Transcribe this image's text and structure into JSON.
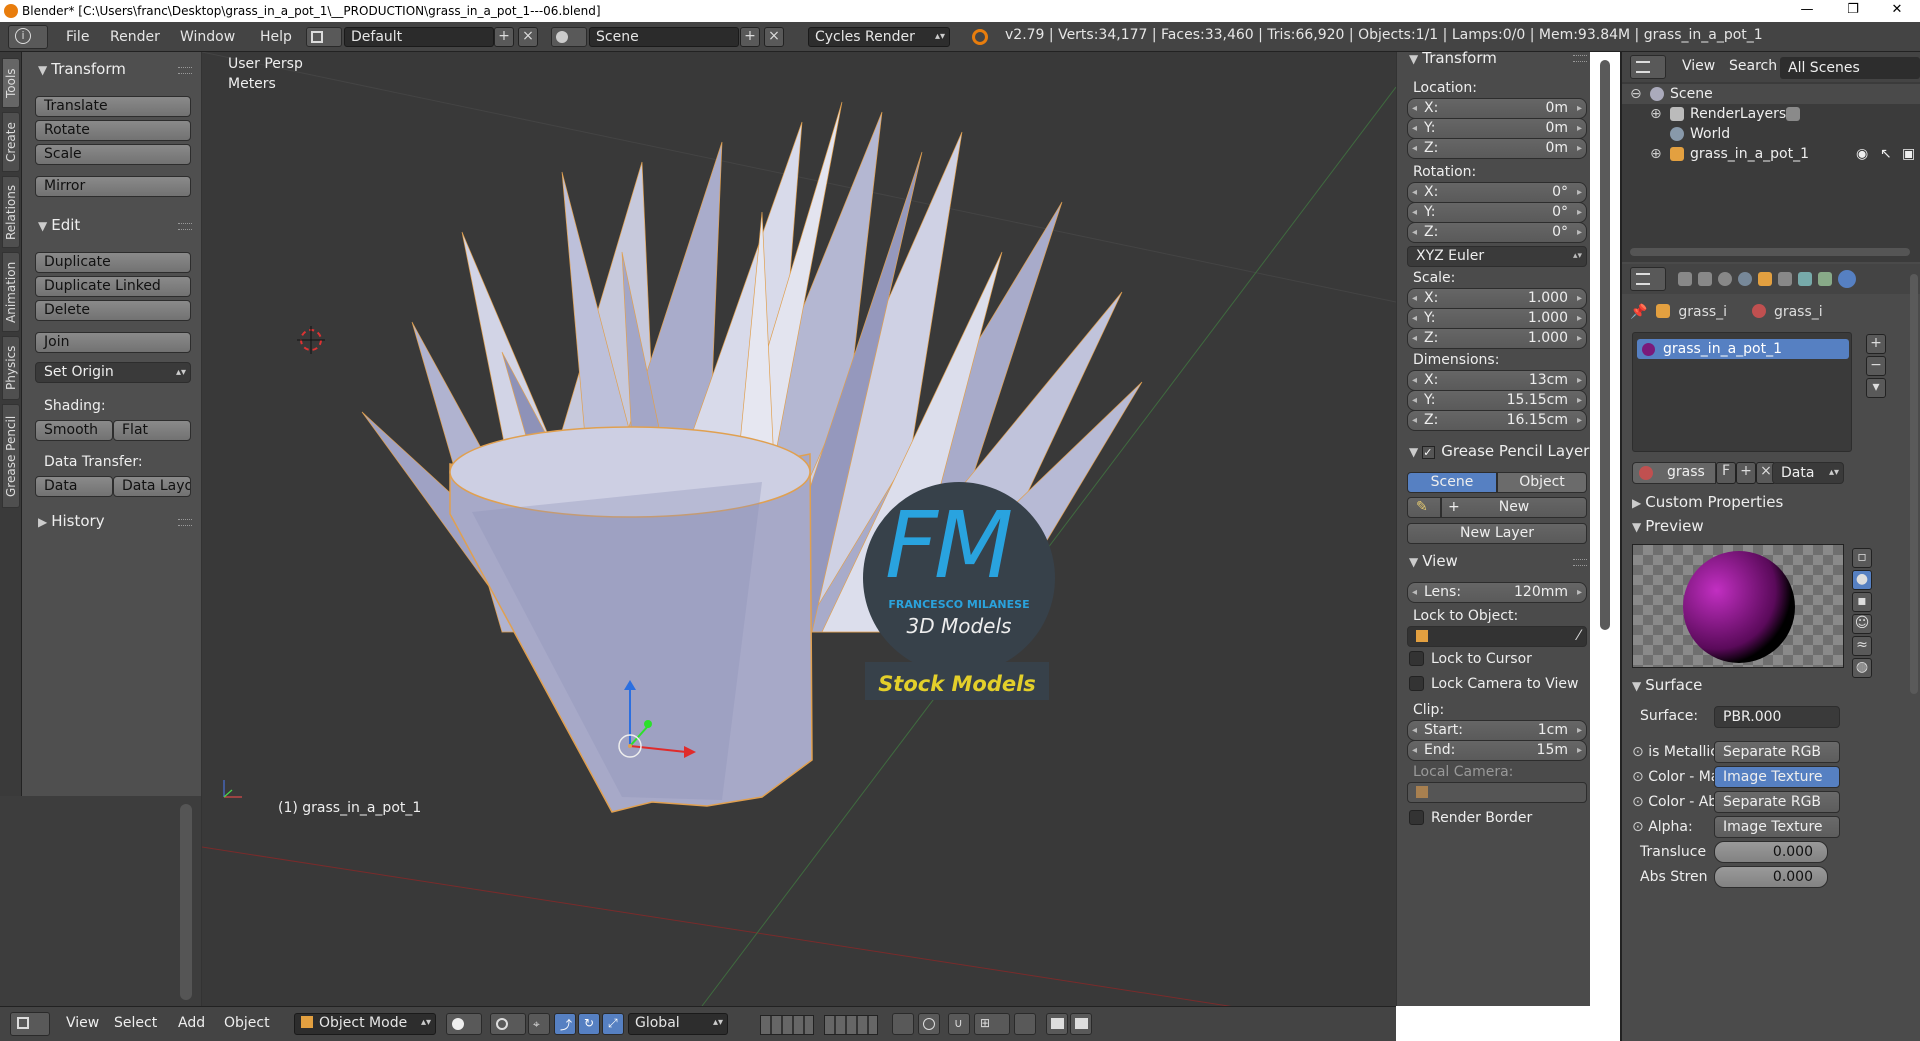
{
  "titlebar": {
    "title": "Blender* [C:\\Users\\franc\\Desktop\\grass_in_a_pot_1\\__PRODUCTION\\grass_in_a_pot_1---06.blend]",
    "minimize": "—",
    "maximize": "❐",
    "close": "✕"
  },
  "menu": {
    "file": "File",
    "render": "Render",
    "window": "Window",
    "help": "Help"
  },
  "header": {
    "layout": "Default",
    "scene": "Scene",
    "engine": "Cycles Render",
    "stats": "v2.79 | Verts:34,177 | Faces:33,460 | Tris:66,920 | Objects:1/1 | Lamps:0/0 | Mem:93.84M | grass_in_a_pot_1"
  },
  "tabs": [
    "Tools",
    "Create",
    "Relations",
    "Animation",
    "Physics",
    "Grease Pencil"
  ],
  "toolshelf": {
    "transform_title": "Transform",
    "translate": "Translate",
    "rotate": "Rotate",
    "scale": "Scale",
    "mirror": "Mirror",
    "edit_title": "Edit",
    "duplicate": "Duplicate",
    "duplicate_linked": "Duplicate Linked",
    "delete": "Delete",
    "join": "Join",
    "set_origin": "Set Origin",
    "shading_label": "Shading:",
    "smooth": "Smooth",
    "flat": "Flat",
    "data_transfer_label": "Data Transfer:",
    "data": "Data",
    "data_layo": "Data Layo",
    "history_title": "History"
  },
  "viewport": {
    "view_name": "User Persp",
    "units": "Meters",
    "object_label": "(1) grass_in_a_pot_1",
    "logo_initials": "FM",
    "logo_name": "FRANCESCO MILANESE",
    "logo_sub": "3D Models",
    "logo_banner": "Stock Models"
  },
  "npanel": {
    "transform_title": "Transform",
    "location_label": "Location:",
    "loc": [
      {
        "k": "X:",
        "v": "0m"
      },
      {
        "k": "Y:",
        "v": "0m"
      },
      {
        "k": "Z:",
        "v": "0m"
      }
    ],
    "rotation_label": "Rotation:",
    "rot": [
      {
        "k": "X:",
        "v": "0°"
      },
      {
        "k": "Y:",
        "v": "0°"
      },
      {
        "k": "Z:",
        "v": "0°"
      }
    ],
    "rotation_mode": "XYZ Euler",
    "scale_label": "Scale:",
    "scl": [
      {
        "k": "X:",
        "v": "1.000"
      },
      {
        "k": "Y:",
        "v": "1.000"
      },
      {
        "k": "Z:",
        "v": "1.000"
      }
    ],
    "dimensions_label": "Dimensions:",
    "dim": [
      {
        "k": "X:",
        "v": "13cm"
      },
      {
        "k": "Y:",
        "v": "15.15cm"
      },
      {
        "k": "Z:",
        "v": "16.15cm"
      }
    ],
    "gp_title": "Grease Pencil Layer",
    "gp_scene": "Scene",
    "gp_object": "Object",
    "gp_new": "New",
    "gp_new_layer": "New Layer",
    "view_title": "View",
    "lens_k": "Lens:",
    "lens_v": "120mm",
    "lock_object_label": "Lock to Object:",
    "lock_cursor": "Lock to Cursor",
    "lock_camera": "Lock Camera to View",
    "clip_label": "Clip:",
    "clip_start_k": "Start:",
    "clip_start_v": "1cm",
    "clip_end_k": "End:",
    "clip_end_v": "15m",
    "local_camera_label": "Local Camera:",
    "render_border": "Render Border"
  },
  "outliner": {
    "view": "View",
    "search": "Search",
    "filter": "All Scenes",
    "items": [
      "Scene",
      "RenderLayers",
      "World",
      "grass_in_a_pot_1"
    ]
  },
  "properties": {
    "breadcrumb1": "grass_i",
    "breadcrumb2": "grass_i",
    "material_slot": "grass_in_a_pot_1",
    "mat_name": "grass",
    "mat_f": "F",
    "mat_link": "Data",
    "custom_props": "Custom Properties",
    "preview": "Preview",
    "surface_title": "Surface",
    "surface_label": "Surface:",
    "surface_value": "PBR.000",
    "inputs": [
      {
        "k": "is Metallic",
        "v": "Separate RGB"
      },
      {
        "k": "Color - Ma",
        "v": "Image Texture"
      },
      {
        "k": "Color - Ab",
        "v": "Separate RGB"
      },
      {
        "k": "Alpha:",
        "v": "Image Texture"
      }
    ],
    "transluce_k": "Transluce",
    "transluce_v": "0.000",
    "abs_k": "Abs Stren",
    "abs_v": "0.000"
  },
  "bottombar": {
    "view": "View",
    "select": "Select",
    "add": "Add",
    "object": "Object",
    "mode": "Object Mode",
    "orientation": "Global"
  },
  "colors": {
    "accent": "#5680c2",
    "viewport_bg": "#393939",
    "panel_bg": "#4b4b4b",
    "logo_blue": "#2a9fd8",
    "banner_yellow": "#e3cf2a"
  }
}
